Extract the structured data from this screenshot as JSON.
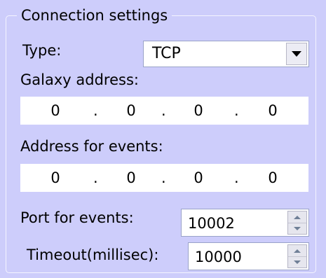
{
  "group": {
    "title": "Connection settings"
  },
  "type_field": {
    "label": "Type:",
    "value": "TCP"
  },
  "galaxy_address": {
    "label": "Galaxy address:",
    "octets": [
      "0",
      "0",
      "0",
      "0"
    ],
    "separator": "."
  },
  "events_address": {
    "label": "Address for events:",
    "octets": [
      "0",
      "0",
      "0",
      "0"
    ],
    "separator": "."
  },
  "port_events": {
    "label": "Port for events:",
    "value": "10002"
  },
  "timeout": {
    "label": "Timeout(millisec):",
    "value": "10000"
  },
  "icons": {
    "dropdown": "chevron-down-icon",
    "spin_up": "spin-up-arrow-icon",
    "spin_down": "spin-down-arrow-icon"
  }
}
